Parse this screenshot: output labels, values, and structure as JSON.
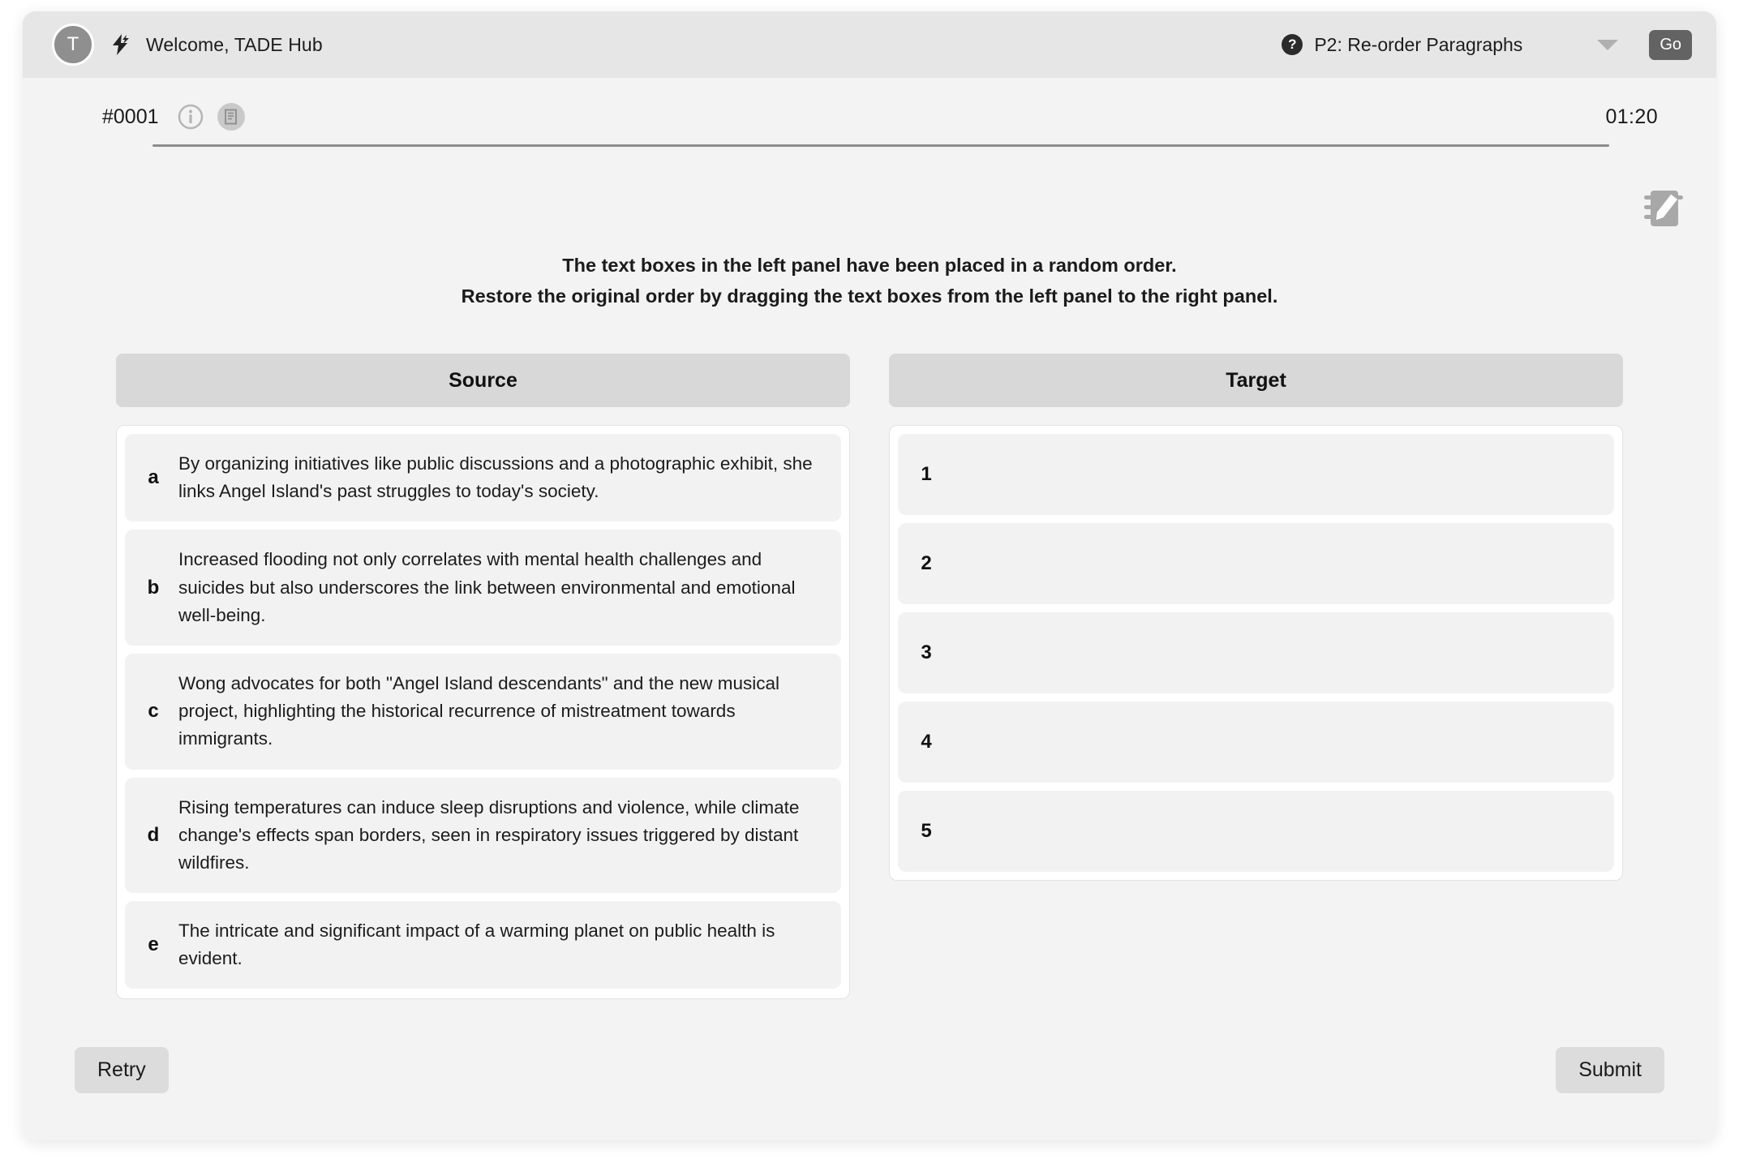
{
  "header": {
    "avatar_initial": "T",
    "bolt_icon": "lightning-bolt-icon",
    "welcome_text": "Welcome, TADE Hub",
    "help_icon_glyph": "?",
    "task_label": "P2: Re-order Paragraphs",
    "chevron_icon": "chevron-down-icon",
    "go_label": "Go"
  },
  "meta": {
    "item_id": "#0001",
    "info_icon": "info-circle-icon",
    "transcript_icon": "document-transcript-icon",
    "timer": "01:20",
    "notepad_icon": "notepad-pencil-icon"
  },
  "instructions": {
    "line1": "The text boxes in the left panel have been placed in a random order.",
    "line2": "Restore the original order by dragging the text boxes from the left panel to the right panel."
  },
  "source": {
    "title": "Source",
    "items": [
      {
        "letter": "a",
        "text": "By organizing initiatives like public discussions and a photographic exhibit, she links Angel Island's past struggles to today's society."
      },
      {
        "letter": "b",
        "text": "Increased flooding not only correlates with mental health challenges and suicides but also underscores the link between environmental and emotional well-being."
      },
      {
        "letter": "c",
        "text": "Wong advocates for both \"Angel Island descendants\" and the new musical project, highlighting the historical recurrence of mistreatment towards immigrants."
      },
      {
        "letter": "d",
        "text": "Rising temperatures can induce sleep disruptions and violence, while climate change's effects span borders, seen in respiratory issues triggered by distant wildfires."
      },
      {
        "letter": "e",
        "text": "The intricate and significant impact of a warming planet on public health is evident."
      }
    ]
  },
  "target": {
    "title": "Target",
    "slots": [
      {
        "number": "1",
        "text": ""
      },
      {
        "number": "2",
        "text": ""
      },
      {
        "number": "3",
        "text": ""
      },
      {
        "number": "4",
        "text": ""
      },
      {
        "number": "5",
        "text": ""
      }
    ]
  },
  "footer": {
    "retry_label": "Retry",
    "submit_label": "Submit"
  },
  "colors": {
    "header_bg": "#e6e6e6",
    "body_bg": "#f3f3f3",
    "panel_header_bg": "#d8d8d8",
    "item_bg": "#f2f2f2",
    "go_button_bg": "#636363",
    "avatar_bg": "#8f8f8f"
  }
}
